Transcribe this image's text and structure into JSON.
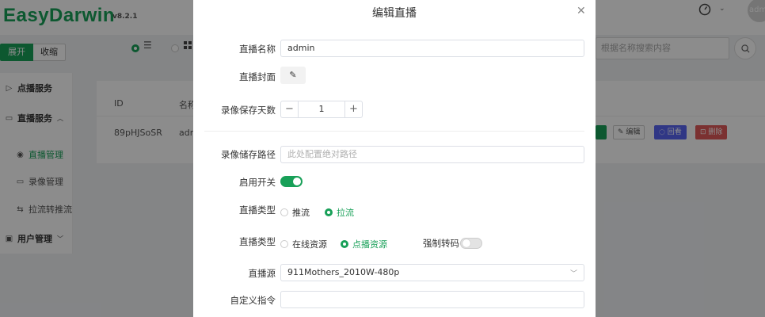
{
  "app": {
    "logo": "EasyDarwin",
    "version": "v8.2.1",
    "avatar_text": "adm"
  },
  "toolbar": {
    "expand_label": "展开",
    "collapse_label": "收缩",
    "list_icon": "list-view-icon",
    "grid_icon": "grid-view-icon"
  },
  "sidebar": {
    "vod": "点播服务",
    "live": "直播服务",
    "live_children": [
      "直播管理",
      "录像管理",
      "拉流转推流"
    ],
    "users": "用户管理"
  },
  "search": {
    "placeholder": "根据名称搜索内容"
  },
  "table": {
    "headers": [
      "ID",
      "名称"
    ],
    "row": {
      "id": "89pHJSoSR",
      "name": "adm"
    },
    "actions": {
      "edit": "编辑",
      "playback": "回看",
      "delete": "删除"
    }
  },
  "modal": {
    "title": "编辑直播",
    "fields": {
      "name_label": "直播名称",
      "name_value": "admin",
      "cover_label": "直播封面",
      "retain_label": "录像保存天数",
      "retain_value": "1",
      "path_label": "录像储存路径",
      "path_placeholder": "此处配置绝对路径",
      "enable_label": "启用开关",
      "enable_on": true,
      "type_label": "直播类型",
      "type_options": [
        "推流",
        "拉流"
      ],
      "type_selected": "拉流",
      "source_type_label": "直播类型",
      "source_type_options": [
        "在线资源",
        "点播资源"
      ],
      "source_type_selected": "点播资源",
      "transcode_label": "强制转码",
      "transcode_on": false,
      "source_label": "直播源",
      "source_value": "911Mothers_2010W-480p",
      "custom_cmd_label": "自定义指令",
      "custom_cmd_value": ""
    }
  },
  "colors": {
    "primary": "#18a058",
    "play": "#5865f2",
    "danger": "#e05a5a"
  }
}
